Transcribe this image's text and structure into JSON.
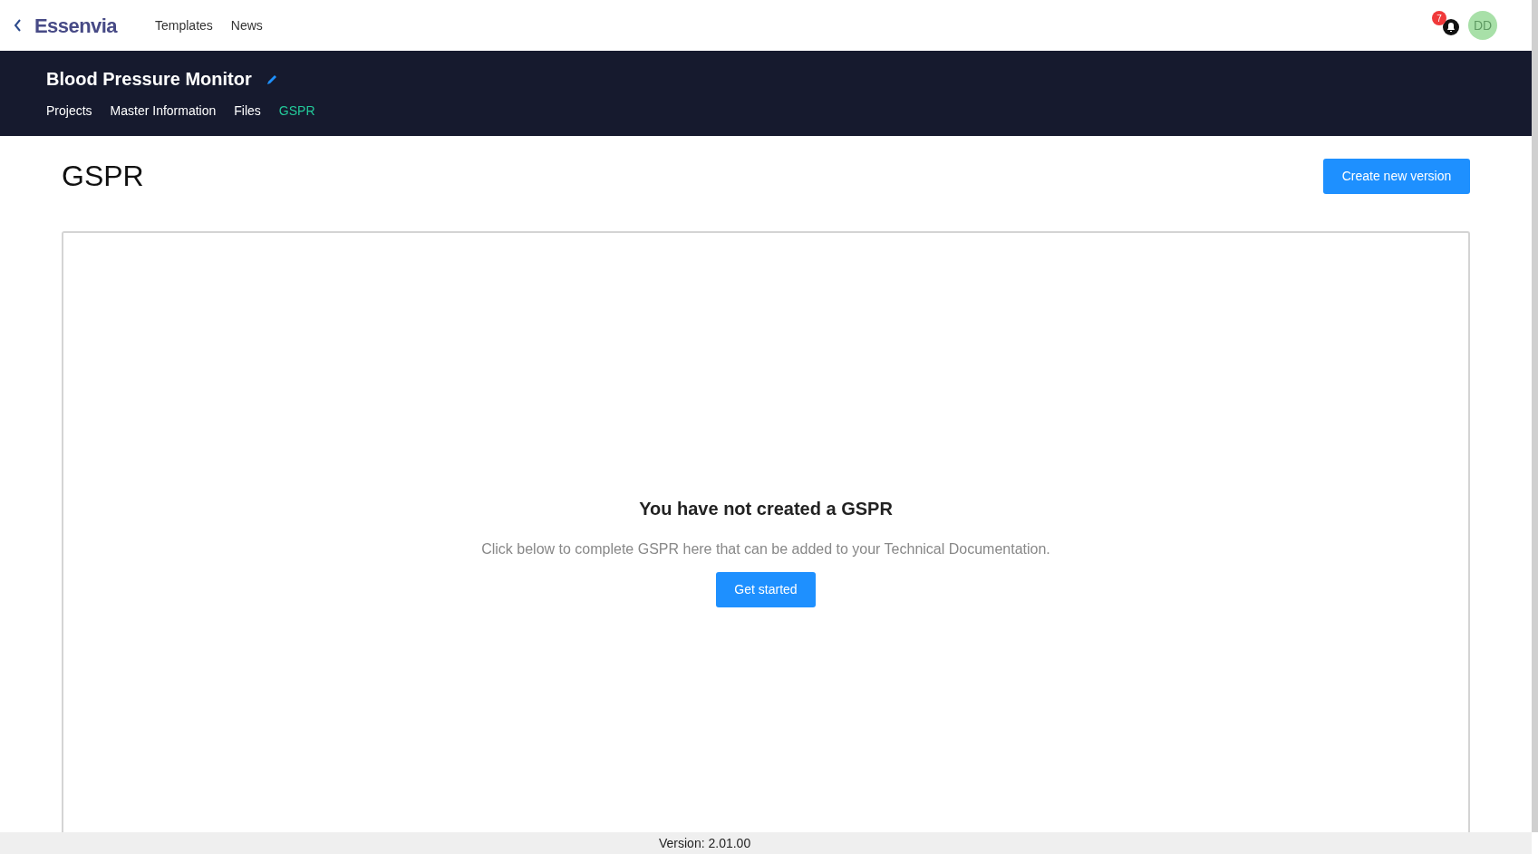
{
  "topbar": {
    "logo": "Essenvia",
    "nav": [
      {
        "label": "Templates"
      },
      {
        "label": "News"
      }
    ],
    "notification_count": "7",
    "avatar": "DD"
  },
  "project": {
    "title": "Blood Pressure Monitor",
    "tabs": [
      {
        "label": "Projects",
        "selected": false
      },
      {
        "label": "Master Information",
        "selected": false
      },
      {
        "label": "Files",
        "selected": false
      },
      {
        "label": "GSPR",
        "selected": true
      }
    ]
  },
  "page": {
    "title": "GSPR",
    "action": "Create new version"
  },
  "empty_state": {
    "heading": "You have not created a GSPR",
    "text": "Click below to complete GSPR here that can be added to your Technical Documentation.",
    "button": "Get started"
  },
  "footer": {
    "version": "Version: 2.01.00"
  }
}
